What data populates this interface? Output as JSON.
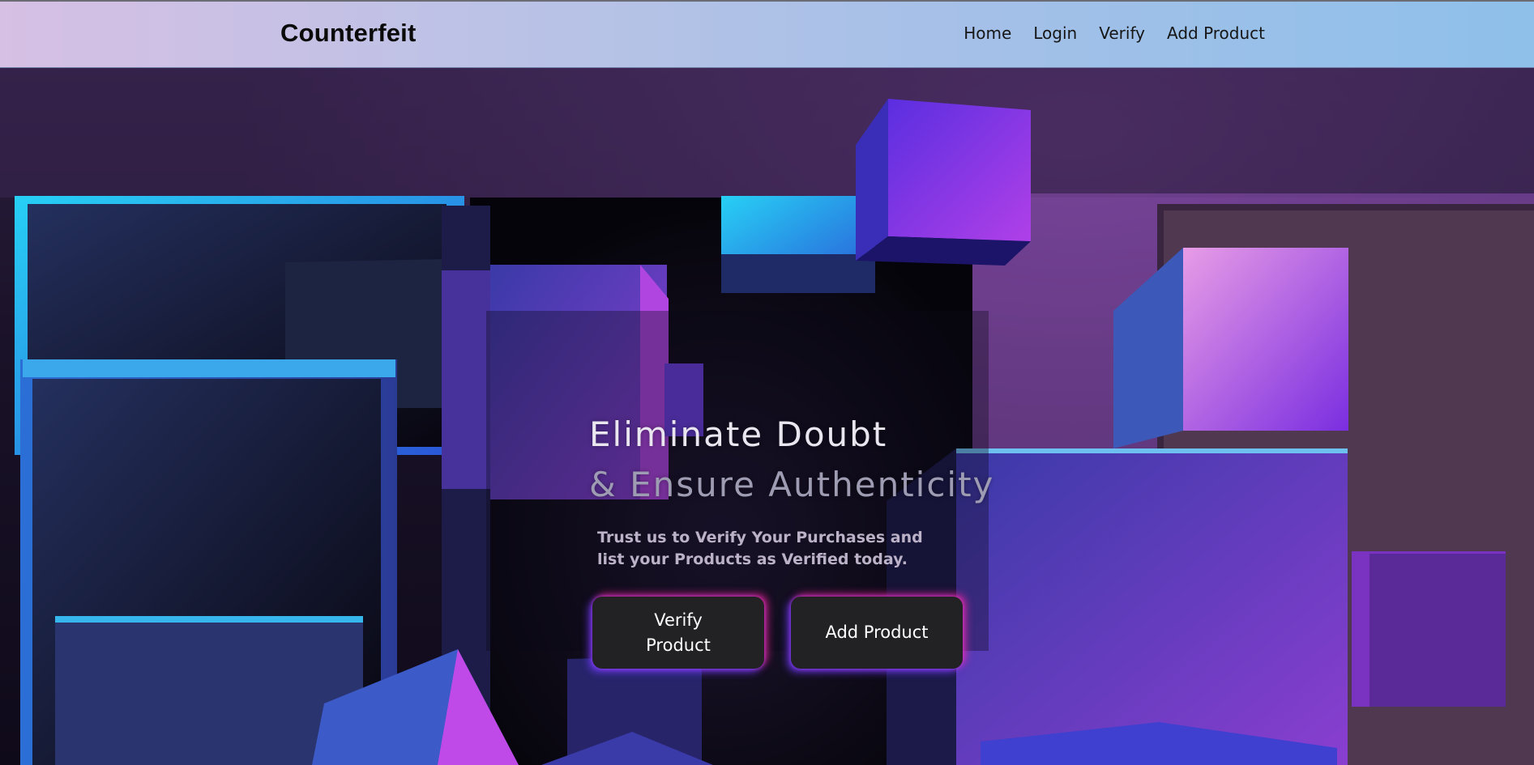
{
  "window": {
    "brand": "Counterfeit"
  },
  "nav": {
    "items": [
      {
        "label": "Home"
      },
      {
        "label": "Login"
      },
      {
        "label": "Verify"
      },
      {
        "label": "Add Product"
      }
    ]
  },
  "hero": {
    "headline_line1": "Eliminate Doubt",
    "headline_line2": "& Ensure Authenticity",
    "subtext": "Trust us to Verify Your Purchases and list your Products as Verified today.",
    "buttons": {
      "verify_line1": "Verify",
      "verify_line2": "Product",
      "add_label": "Add Product"
    }
  },
  "colors": {
    "nav_gradient_start": "#d6c0e4",
    "nav_gradient_end": "#8ec0ea",
    "button_bg": "#222224",
    "glow_blue": "#6e3cff",
    "glow_pink": "#ff28a0"
  }
}
